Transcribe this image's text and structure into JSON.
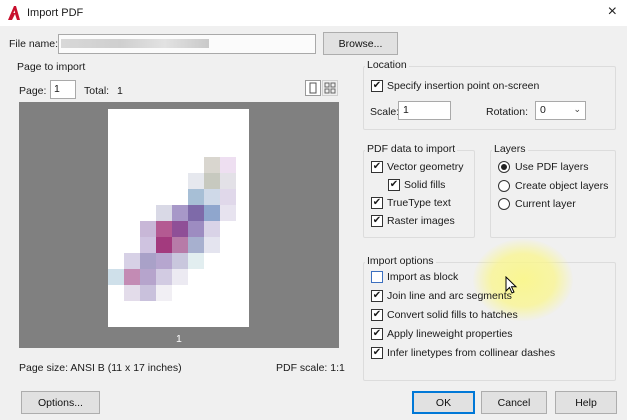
{
  "window": {
    "title": "Import PDF",
    "close_glyph": "×",
    "accent": "#c8102e"
  },
  "file": {
    "label": "File name:",
    "value": "",
    "browse_label": "Browse..."
  },
  "page_to_import": {
    "title": "Page to import",
    "page_label": "Page:",
    "page_value": "1",
    "total_label": "Total:",
    "total_value": "1",
    "page_number": "1",
    "page_size": "Page size: ANSI B (11 x 17 inches)",
    "pdf_scale": "PDF scale: 1:1",
    "view_icons": [
      "single-page-icon",
      "thumbnails-icon"
    ]
  },
  "location": {
    "title": "Location",
    "specify_label": "Specify insertion point on-screen",
    "specify_checked": true,
    "scale_label": "Scale:",
    "scale_value": "1",
    "rotation_label": "Rotation:",
    "rotation_value": "0"
  },
  "pdf_data": {
    "title": "PDF data to import",
    "items": [
      {
        "label": "Vector geometry",
        "checked": true
      },
      {
        "label": "Solid fills",
        "checked": true
      },
      {
        "label": "TrueType text",
        "checked": true
      },
      {
        "label": "Raster images",
        "checked": true
      }
    ]
  },
  "layers": {
    "title": "Layers",
    "options": [
      {
        "label": "Use PDF layers",
        "selected": true
      },
      {
        "label": "Create object layers",
        "selected": false
      },
      {
        "label": "Current layer",
        "selected": false
      }
    ]
  },
  "import_options": {
    "title": "Import options",
    "items": [
      {
        "label": "Import as block",
        "checked": false
      },
      {
        "label": "Join line and arc segments",
        "checked": true
      },
      {
        "label": "Convert solid fills to hatches",
        "checked": true
      },
      {
        "label": "Apply lineweight properties",
        "checked": true
      },
      {
        "label": "Infer linetypes from collinear dashes",
        "checked": true
      }
    ]
  },
  "buttons": {
    "options": "Options...",
    "ok": "OK",
    "cancel": "Cancel",
    "help": "Help"
  }
}
